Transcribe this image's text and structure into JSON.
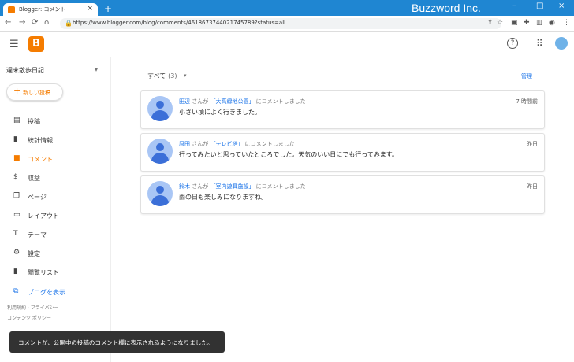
{
  "browser": {
    "tab_title": "Blogger: コメント",
    "brand_overlay": "Buzzword Inc.",
    "url": "https://www.blogger.com/blog/comments/4618673744021745789?status=all"
  },
  "app": {
    "logo_letter": "B"
  },
  "sidebar": {
    "blog_name": "週末散歩日記",
    "new_post_label": "新しい投稿",
    "items": [
      {
        "label": "投稿",
        "icon": "posts-icon"
      },
      {
        "label": "統計情報",
        "icon": "stats-icon"
      },
      {
        "label": "コメント",
        "icon": "comments-icon"
      },
      {
        "label": "収益",
        "icon": "earnings-icon"
      },
      {
        "label": "ページ",
        "icon": "pages-icon"
      },
      {
        "label": "レイアウト",
        "icon": "layout-icon"
      },
      {
        "label": "テーマ",
        "icon": "theme-icon"
      },
      {
        "label": "設定",
        "icon": "settings-icon"
      },
      {
        "label": "閲覧リスト",
        "icon": "reading-list-icon"
      }
    ],
    "view_blog": "ブログを表示",
    "footer_line1": "利用規約 · プライバシー ·",
    "footer_line2": "コンテンツ ポリシー"
  },
  "main": {
    "filter_label": "すべて",
    "filter_count": "(3)",
    "manage_label": "管理",
    "comments": [
      {
        "author": "田辺",
        "between": " さんが ",
        "post": "「大高緑地公園」",
        "suffix": " にコメントしました",
        "time": "7 時間前",
        "text": "小さい頃によく行きました。"
      },
      {
        "author": "原田",
        "between": " さんが ",
        "post": "「テレビ塔」",
        "suffix": " にコメントしました",
        "time": "昨日",
        "text": "行ってみたいと思っていたところでした。天気のいい日にでも行ってみます。"
      },
      {
        "author": "鈴木",
        "between": " さんが ",
        "post": "「室内遊具施設」",
        "suffix": " にコメントしました",
        "time": "昨日",
        "text": "雨の日も楽しみになりますね。"
      }
    ]
  },
  "toast": {
    "message": "コメントが、公開中の投稿のコメント欄に表示されるようになりました。"
  },
  "colors": {
    "accent": "#f57c00",
    "link": "#1a73e8",
    "chrome": "#1f86d2"
  }
}
